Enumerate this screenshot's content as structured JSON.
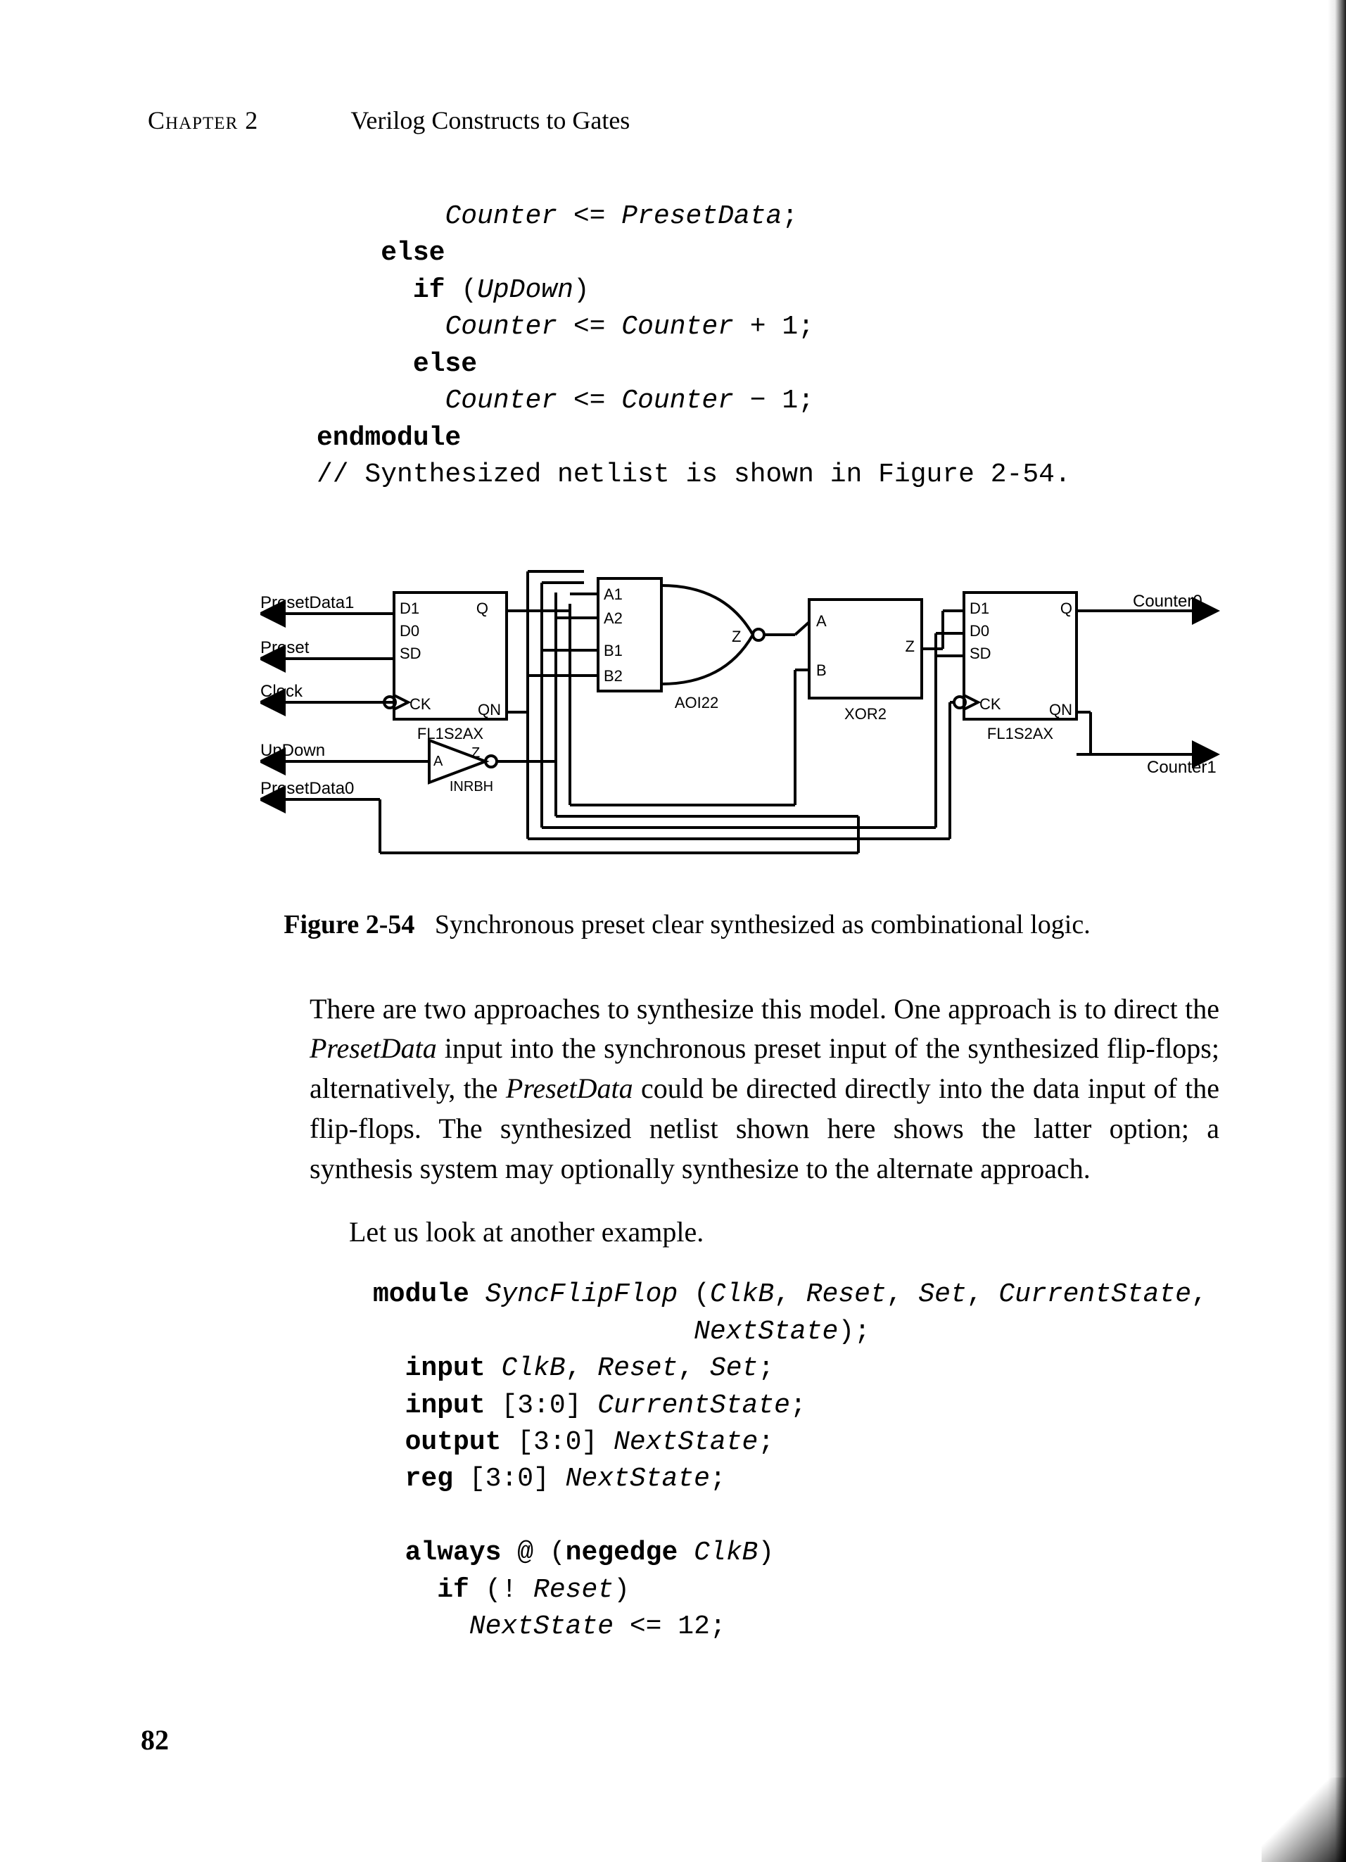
{
  "header": {
    "chapter": "Chapter 2",
    "title": "Verilog Constructs to Gates"
  },
  "code1": {
    "l1_a": "Counter",
    "l1_b": " <= ",
    "l1_c": "PresetData",
    "l1_d": ";",
    "l2_kw": "else",
    "l3_kw": "if",
    "l3_a": " (",
    "l3_b": "UpDown",
    "l3_c": ")",
    "l4_a": "Counter",
    "l4_b": " <= ",
    "l4_c": "Counter",
    "l4_d": " + 1;",
    "l5_kw": "else",
    "l6_a": "Counter",
    "l6_b": " <= ",
    "l6_c": "Counter",
    "l6_d": " − 1;",
    "l7_kw": "endmodule",
    "l8": "// Synthesized netlist is shown in Figure 2-54."
  },
  "diagram": {
    "inputs": {
      "pd1": "PresetData1",
      "preset": "Preset",
      "clock": "Clock",
      "updown": "UpDown",
      "pd0": "PresetData0"
    },
    "outputs": {
      "c0": "Counter0",
      "c1": "Counter1"
    },
    "cells": {
      "ff_left": "FL1S2AX",
      "ff_right": "FL1S2AX",
      "aoi": "AOI22",
      "xor": "XOR2",
      "inv": "INRBH"
    },
    "pins": {
      "d1": "D1",
      "d0": "D0",
      "sd": "SD",
      "ck": "CK",
      "q": "Q",
      "qn": "QN",
      "a1": "A1",
      "a2": "A2",
      "b1": "B1",
      "b2": "B2",
      "a": "A",
      "b": "B",
      "z": "Z"
    }
  },
  "figcaption": {
    "label": "Figure 2-54",
    "text": "Synchronous preset clear synthesized as combinational logic."
  },
  "para1_a": "There are two approaches to synthesize this model. One approach is to direct the ",
  "para1_b": "PresetData",
  "para1_c": " input into the synchronous preset input of the synthesized flip-flops; alternatively, the ",
  "para1_d": "PresetData",
  "para1_e": " could be directed directly into the data input of the flip-flops. The synthesized netlist shown here shows the latter option; a synthesis system may optionally synthesize to the alternate approach.",
  "para2": "Let us look at another example.",
  "code2": {
    "l1_kw": "module",
    "l1_a": " ",
    "l1_b": "SyncFlipFlop",
    "l1_c": " (",
    "l1_d": "ClkB",
    "l1_e": ", ",
    "l1_f": "Reset",
    "l1_g": ", ",
    "l1_h": "Set",
    "l1_i": ", ",
    "l1_j": "CurrentState",
    "l1_k": ",",
    "l1b_a": "NextState",
    "l1b_b": ");",
    "l2_kw": "input",
    "l2_a": " ",
    "l2_b": "ClkB",
    "l2_c": ", ",
    "l2_d": "Reset",
    "l2_e": ", ",
    "l2_f": "Set",
    "l2_g": ";",
    "l3_kw": "input",
    "l3_a": " [3:0] ",
    "l3_b": "CurrentState",
    "l3_c": ";",
    "l4_kw": "output",
    "l4_a": " [3:0] ",
    "l4_b": "NextState",
    "l4_c": ";",
    "l5_kw": "reg",
    "l5_a": " [3:0] ",
    "l5_b": "NextState",
    "l5_c": ";",
    "l6_kw1": "always",
    "l6_a": " @ (",
    "l6_kw2": "negedge",
    "l6_b": " ",
    "l6_c": "ClkB",
    "l6_d": ")",
    "l7_kw": "if",
    "l7_a": " (! ",
    "l7_b": "Reset",
    "l7_c": ")",
    "l8_a": "NextState",
    "l8_b": " <= 12;"
  },
  "pagenum": "82"
}
